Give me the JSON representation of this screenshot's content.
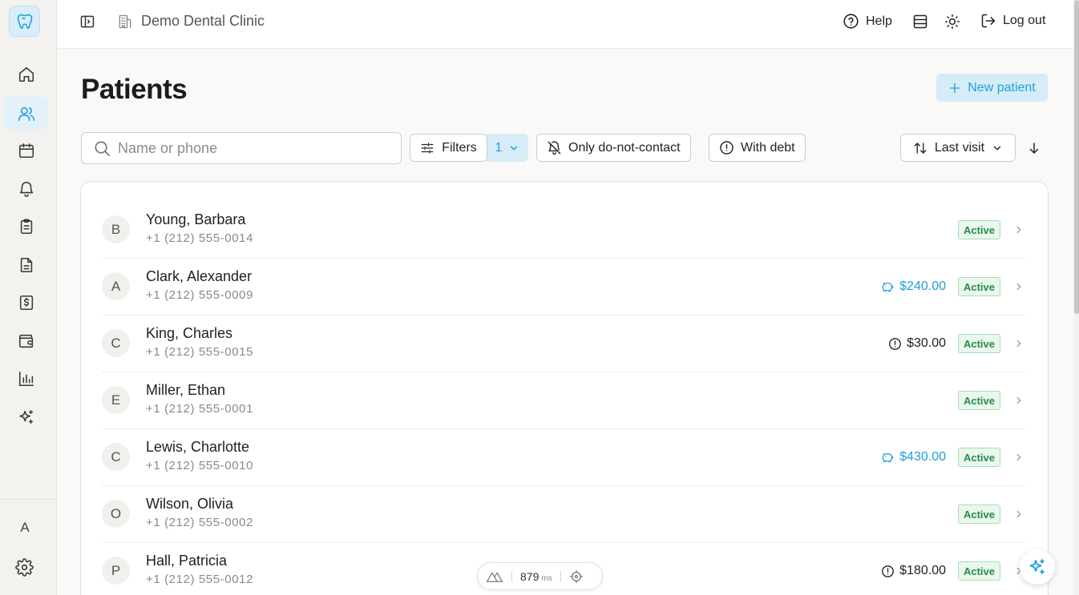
{
  "app": {
    "clinic_name": "Demo Dental Clinic",
    "brand_color": "#1e9fdc"
  },
  "sidebar": {
    "items": [
      {
        "icon": "home-icon",
        "active": false
      },
      {
        "icon": "users-icon",
        "active": true
      },
      {
        "icon": "calendar-icon",
        "active": false
      },
      {
        "icon": "bell-icon",
        "active": false
      },
      {
        "icon": "clipboard-icon",
        "active": false
      },
      {
        "icon": "document-icon",
        "active": false
      },
      {
        "icon": "invoice-icon",
        "active": false
      },
      {
        "icon": "wallet-icon",
        "active": false
      },
      {
        "icon": "bar-chart-icon",
        "active": false
      },
      {
        "icon": "sparkles-icon",
        "active": false
      }
    ],
    "user_initial": "A"
  },
  "topbar": {
    "help_label": "Help",
    "logout_label": "Log out"
  },
  "page": {
    "title": "Patients",
    "new_patient_label": "New patient"
  },
  "toolbar": {
    "search_placeholder": "Name or phone",
    "search_value": "",
    "filters_label": "Filters",
    "filters_count": "1",
    "dnc_label": "Only do-not-contact",
    "debt_label": "With debt",
    "sort_label": "Last visit"
  },
  "patients": [
    {
      "initial": "B",
      "name": "Young, Barbara",
      "phone": "+1 (212) 555-0014",
      "balance": "",
      "balance_type": "",
      "status": "Active"
    },
    {
      "initial": "A",
      "name": "Clark, Alexander",
      "phone": "+1 (212) 555-0009",
      "balance": "$240.00",
      "balance_type": "credit",
      "status": "Active"
    },
    {
      "initial": "C",
      "name": "King, Charles",
      "phone": "+1 (212) 555-0015",
      "balance": "$30.00",
      "balance_type": "debt",
      "status": "Active"
    },
    {
      "initial": "E",
      "name": "Miller, Ethan",
      "phone": "+1 (212) 555-0001",
      "balance": "",
      "balance_type": "",
      "status": "Active"
    },
    {
      "initial": "C",
      "name": "Lewis, Charlotte",
      "phone": "+1 (212) 555-0010",
      "balance": "$430.00",
      "balance_type": "credit",
      "status": "Active"
    },
    {
      "initial": "O",
      "name": "Wilson, Olivia",
      "phone": "+1 (212) 555-0002",
      "balance": "",
      "balance_type": "",
      "status": "Active"
    },
    {
      "initial": "P",
      "name": "Hall, Patricia",
      "phone": "+1 (212) 555-0012",
      "balance": "$180.00",
      "balance_type": "debt",
      "status": "Active"
    }
  ],
  "perf": {
    "value": "879",
    "unit": "ms"
  }
}
